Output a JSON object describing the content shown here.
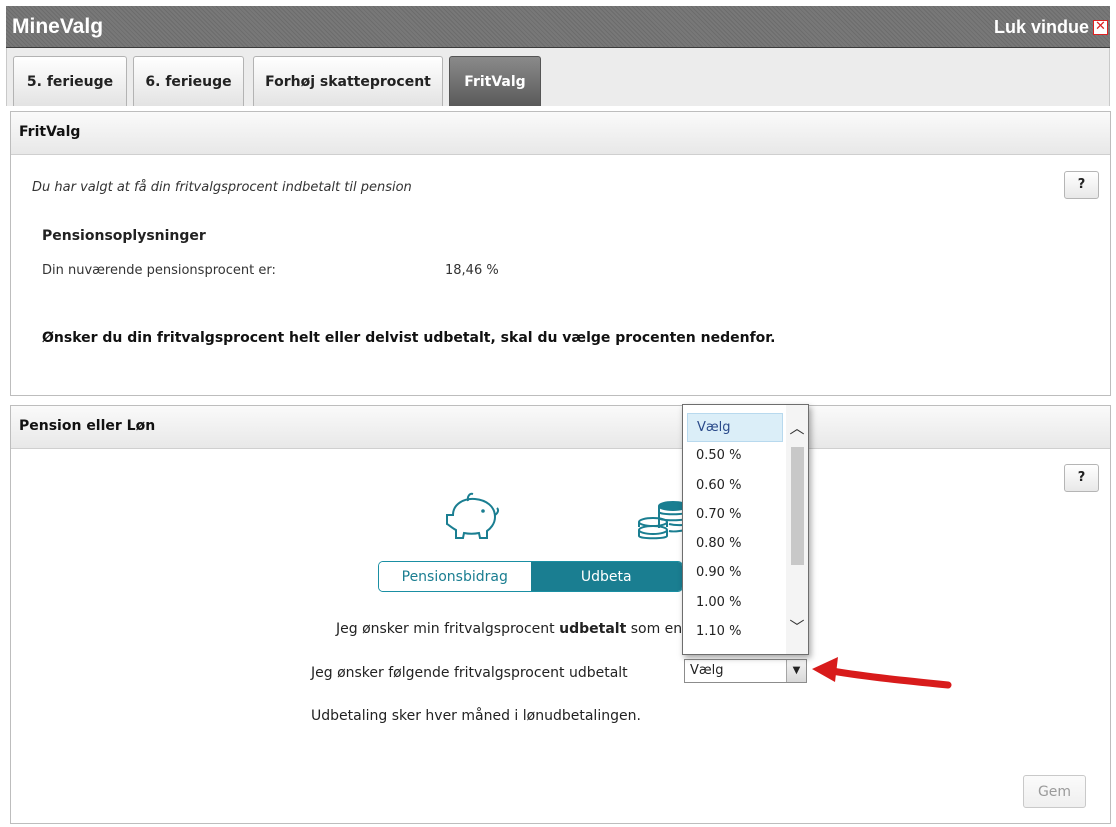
{
  "window": {
    "title": "MineValg",
    "close_label": "Luk vindue"
  },
  "tabs": [
    {
      "label": "5. ferieuge",
      "active": false
    },
    {
      "label": "6. ferieuge",
      "active": false
    },
    {
      "label": "Forhøj skatteprocent",
      "active": false
    },
    {
      "label": "FritValg",
      "active": true
    }
  ],
  "fritvalg_panel": {
    "title": "FritValg",
    "help_label": "?",
    "intro": "Du har valgt at få din fritvalgsprocent indbetalt til pension",
    "section_heading": "Pensionsoplysninger",
    "current_label": "Din nuværende pensionsprocent er:",
    "current_value": "18,46 %",
    "notice": "Ønsker du din fritvalgsprocent helt eller delvist udbetalt, skal du vælge procenten nedenfor."
  },
  "pension_panel": {
    "title": "Pension eller Løn",
    "help_label": "?",
    "icons": [
      "piggy-bank-icon",
      "coins-icon"
    ],
    "toggle": {
      "left": "Pensionsbidrag",
      "right": "Udbeta",
      "selected": "right"
    },
    "desire_prefix": "Jeg ønsker min fritvalgsprocent ",
    "desire_bold": "udbetalt",
    "desire_suffix": " som en",
    "select_label": "Jeg ønsker følgende fritvalgsprocent udbetalt",
    "select_value": "Vælg",
    "payment_note": "Udbetaling sker hver måned i lønudbetalingen.",
    "save_label": "Gem"
  },
  "dropdown": {
    "options": [
      "Vælg",
      "0.50 %",
      "0.60 %",
      "0.70 %",
      "0.80 %",
      "0.90 %",
      "1.00 %",
      "1.10 %"
    ],
    "highlighted": "Vælg"
  },
  "colors": {
    "accent": "#1a7e91",
    "arrow": "#d81b1b",
    "titlebar": "#6c6c6c"
  }
}
